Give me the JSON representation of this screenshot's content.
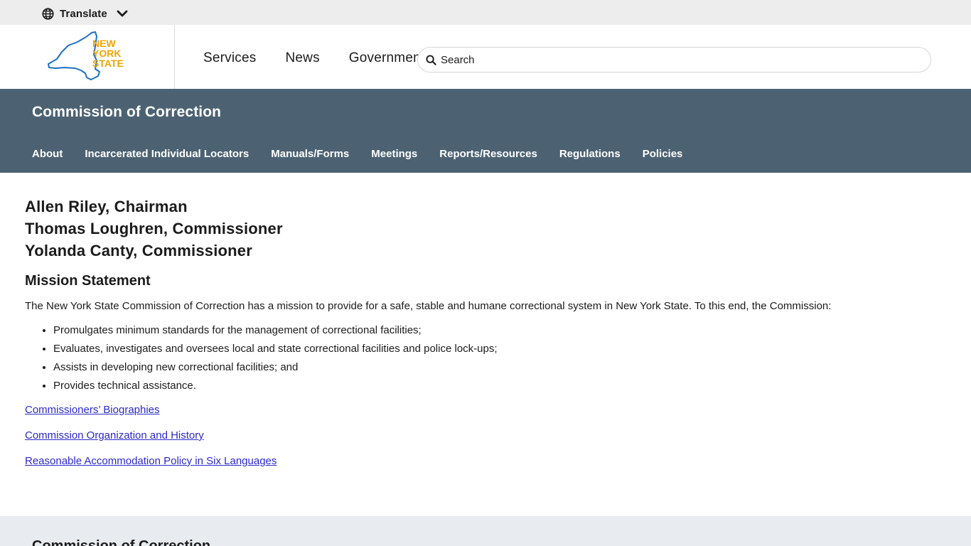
{
  "translate": {
    "label": "Translate"
  },
  "header": {
    "logo_lines": [
      "NEW",
      "YORK",
      "STATE"
    ],
    "nav": [
      "Services",
      "News",
      "Government"
    ],
    "search_placeholder": "Search"
  },
  "agency": {
    "title": "Commission of Correction",
    "nav": [
      "About",
      "Incarcerated Individual Locators",
      "Manuals/Forms",
      "Meetings",
      "Reports/Resources",
      "Regulations",
      "Policies"
    ]
  },
  "content": {
    "names": [
      "Allen Riley, Chairman",
      "Thomas Loughren, Commissioner",
      "Yolanda Canty, Commissioner"
    ],
    "mission_heading": "Mission Statement",
    "mission_text": "The New York State Commission of Correction has a mission to provide for a safe, stable and humane correctional system in New York State. To this end, the Commission:",
    "mission_items": [
      "Promulgates minimum standards for the management of correctional facilities;",
      "Evaluates, investigates and oversees local and state correctional facilities and police lock-ups;",
      "Assists in developing new correctional facilities; and",
      "Provides technical assistance."
    ],
    "links": [
      "Commissioners’ Biographies",
      "Commission Organization and History",
      "Reasonable Accommodation Policy in Six Languages"
    ]
  },
  "footer": {
    "title": "Commission of Correction"
  },
  "colors": {
    "agency_band": "#4c6272",
    "logo_gold": "#f1a300",
    "logo_blue": "#1f70c1",
    "link": "#2a2ac8",
    "translate_bar": "#ededed",
    "footer": "#e8ecf0"
  },
  "icons": {
    "translate": "globe-icon",
    "translate_toggle": "chevron-down-icon",
    "search": "search-icon"
  }
}
